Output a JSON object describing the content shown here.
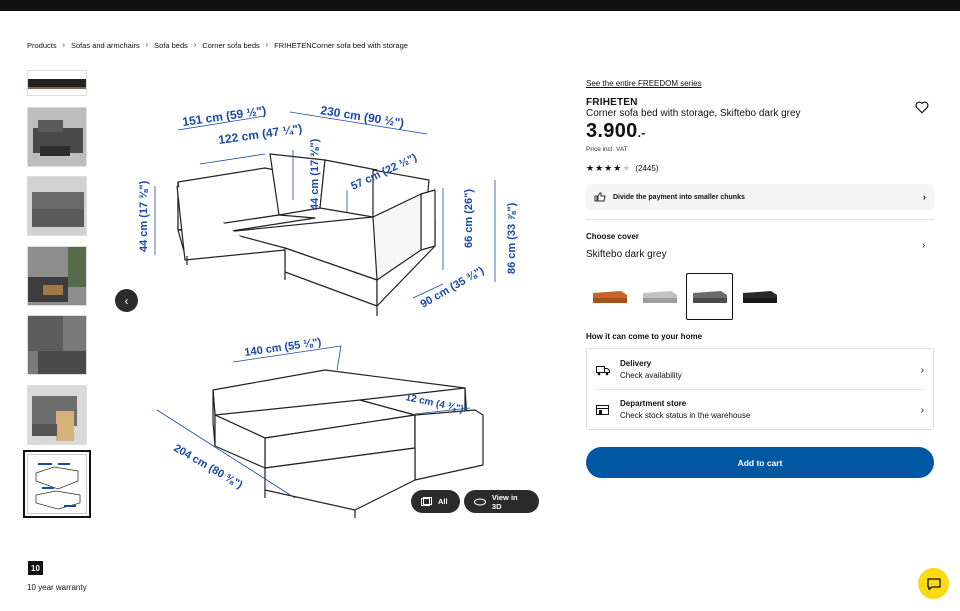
{
  "breadcrumb": [
    "Products",
    "Sofas and armchairs",
    "Sofa beds",
    "Corner sofa beds",
    "FRIHETENCorner sofa bed with storage"
  ],
  "gallery": {
    "all_label": "All",
    "view3d_label": "View in 3D",
    "dims_top": {
      "back_depth": "151 cm (59 ½\")",
      "back_depth_inner": "122 cm (47 ¼\")",
      "width": "230 cm (90 ½\")",
      "seat_depth": "57 cm (22 ½\")",
      "back_height": "44 cm (17 ⅜\")",
      "seat_height": "44 cm (17 ⅜\")",
      "arm_height": "66 cm (26\")",
      "total_height": "86 cm (33 ⅞\")",
      "depth": "90 cm (35 ⅜\")"
    },
    "dims_bottom": {
      "bed_width": "140 cm (55 ⅛\")",
      "bed_length": "204 cm (80 ⅜\")",
      "arm_width": "12 cm (4 ¾\")"
    }
  },
  "product": {
    "series_link": "See the entire FREEDOM series",
    "name": "FRIHETEN",
    "description": "Corner sofa bed with storage, Skiftebo dark grey",
    "price": "3.900",
    "price_suffix": ".-",
    "price_note": "Price incl. VAT",
    "rating_stars": 4,
    "rating_count": "(2445)",
    "payment_text": "Divide the payment into smaller chunks"
  },
  "cover": {
    "label": "Choose cover",
    "selected": "Skiftebo dark grey",
    "swatches": [
      {
        "name": "orange",
        "color": "#c8642a"
      },
      {
        "name": "light-grey",
        "color": "#b8b8b8"
      },
      {
        "name": "dark-grey",
        "color": "#6b6b6b"
      },
      {
        "name": "black",
        "color": "#2a2a2a"
      }
    ]
  },
  "availability": {
    "label": "How it can come to your home",
    "delivery_title": "Delivery",
    "delivery_sub": "Check availability",
    "store_title": "Department store",
    "store_sub": "Check stock status in the warehouse"
  },
  "cart_label": "Add to cart",
  "warranty": {
    "badge": "10",
    "text": "10 year warranty"
  },
  "colors": {
    "cart": "#0058a3",
    "chat": "#fbd914",
    "dims": "#1a4aa8"
  }
}
